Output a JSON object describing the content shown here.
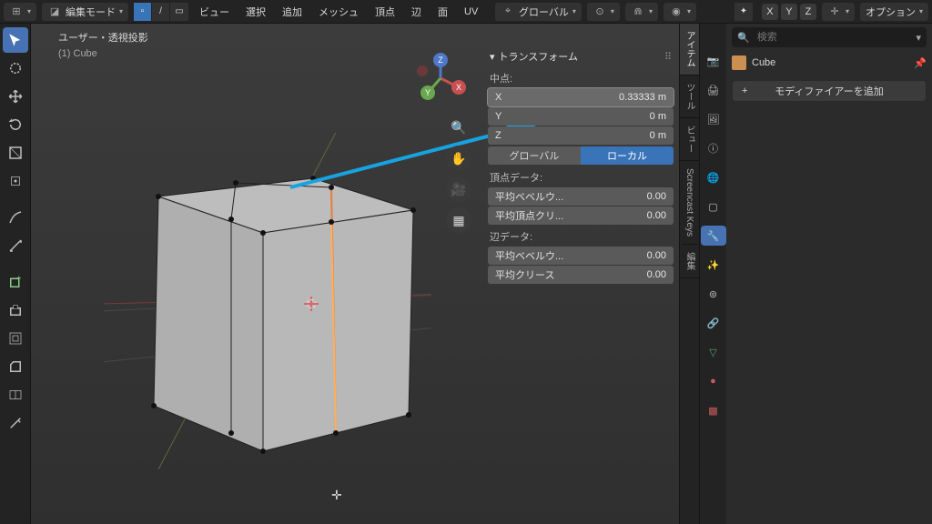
{
  "topbar": {
    "mode_label": "編集モード",
    "menu": {
      "view": "ビュー",
      "select": "選択",
      "add": "追加",
      "mesh": "メッシュ",
      "vertex": "頂点",
      "edge": "辺",
      "face": "面",
      "uv": "UV"
    },
    "orientation": "グローバル",
    "options": "オプション"
  },
  "overlay": {
    "title": "ユーザー・透視投影",
    "sub": "(1) Cube"
  },
  "transform": {
    "header": "トランスフォーム",
    "median": "中点:",
    "x": {
      "label": "X",
      "value": "0.33333 m"
    },
    "y": {
      "label": "Y",
      "value": "0 m"
    },
    "z": {
      "label": "Z",
      "value": "0 m"
    },
    "space": {
      "global": "グローバル",
      "local": "ローカル"
    },
    "vertex_data": "頂点データ:",
    "mean_bevel": {
      "label": "平均ベベルウ...",
      "value": "0.00"
    },
    "mean_crease_v": {
      "label": "平均頂点クリ...",
      "value": "0.00"
    },
    "edge_data": "辺データ:",
    "mean_bevel_e": {
      "label": "平均ベベルウ...",
      "value": "0.00"
    },
    "mean_crease_e": {
      "label": "平均クリース",
      "value": "0.00"
    }
  },
  "side_tabs": {
    "item": "アイテム",
    "tool": "ツール",
    "view": "ビュー",
    "sk": "Screencast Keys",
    "edit": "編集"
  },
  "xyz": {
    "x": "X",
    "y": "Y",
    "z": "Z"
  },
  "props": {
    "search_placeholder": "検索",
    "object_name": "Cube",
    "add_modifier": "モディファイアーを追加"
  }
}
